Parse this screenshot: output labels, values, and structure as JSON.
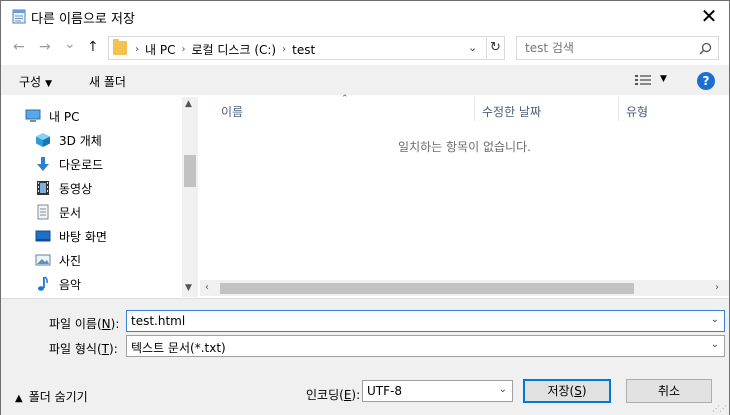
{
  "window": {
    "title": "다른 이름으로 저장",
    "close": "✕"
  },
  "nav": {
    "back": "←",
    "forward": "→",
    "recent": "⌄",
    "up": "↑",
    "breadcrumbs": [
      "내 PC",
      "로컬 디스크 (C:)",
      "test"
    ],
    "search_placeholder": "test 검색"
  },
  "toolbar": {
    "organize": "구성",
    "new_folder": "새 폴더",
    "help": "?"
  },
  "sidebar": {
    "items": [
      {
        "label": "내 PC",
        "icon": "computer-icon"
      },
      {
        "label": "3D 개체",
        "icon": "cube-icon"
      },
      {
        "label": "다운로드",
        "icon": "download-icon"
      },
      {
        "label": "동영상",
        "icon": "film-icon"
      },
      {
        "label": "문서",
        "icon": "document-icon"
      },
      {
        "label": "바탕 화면",
        "icon": "desktop-icon"
      },
      {
        "label": "사진",
        "icon": "picture-icon"
      },
      {
        "label": "음악",
        "icon": "music-icon"
      }
    ]
  },
  "list": {
    "columns": [
      "이름",
      "수정한 날짜",
      "유형"
    ],
    "empty_message": "일치하는 항목이 없습니다."
  },
  "form": {
    "filename_label_prefix": "파일 이름(",
    "filename_label_key": "N",
    "filename_label_suffix": "):",
    "filename_value": "test.html",
    "filetype_label_prefix": "파일 형식(",
    "filetype_label_key": "T",
    "filetype_label_suffix": "):",
    "filetype_value": "텍스트 문서(*.txt)",
    "encoding_label_prefix": "인코딩(",
    "encoding_label_key": "E",
    "encoding_label_suffix": "):",
    "encoding_value": "UTF-8",
    "hide_folders": "폴더 숨기기",
    "save_prefix": "저장(",
    "save_key": "S",
    "save_suffix": ")",
    "cancel": "취소"
  },
  "colors": {
    "accent": "#0078d7",
    "folder": "#f4c24f",
    "help": "#1c6fd0"
  }
}
